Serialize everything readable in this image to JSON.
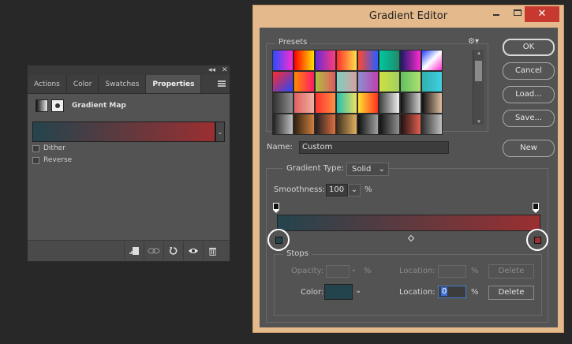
{
  "properties_panel": {
    "tabs": [
      {
        "label": "Actions",
        "active": false
      },
      {
        "label": "Color",
        "active": false
      },
      {
        "label": "Swatches",
        "active": false
      },
      {
        "label": "Properties",
        "active": true
      }
    ],
    "topstrip": {
      "collapse": "◂◂",
      "close": "✕"
    },
    "adjustment_title": "Gradient Map",
    "gradient": {
      "start_color": "#24444d",
      "end_color": "#9b2f31"
    },
    "dropdown_arrow": "⌄",
    "dither_label": "Dither",
    "reverse_label": "Reverse",
    "dither_checked": false,
    "reverse_checked": false,
    "bottom_icons": [
      "clip-to-layer-icon",
      "view-previous-icon",
      "reset-icon",
      "visibility-eye-icon",
      "trash-icon"
    ]
  },
  "gradient_editor": {
    "title": "Gradient Editor",
    "titlebar": {
      "minimize": "",
      "maximize": "",
      "close": "✕"
    },
    "presets_label": "Presets",
    "gear": "⚙▾",
    "preset_swatches": [
      "linear-gradient(90deg,#2a4cff,#ff2bd0)",
      "linear-gradient(90deg,#ff0000,#ffe000)",
      "linear-gradient(90deg,#6a2bd6,#ff3b7a)",
      "linear-gradient(90deg,#ff2d2d,#ffe14a)",
      "linear-gradient(90deg,#ff4a2a,#2a5bff)",
      "linear-gradient(90deg,#00c8a0,#1f8a6c)",
      "linear-gradient(90deg,#1a1a6a,#ff2bd0)",
      "linear-gradient(135deg,#1f3cff,#ffffff,#ff2bd0)",
      "linear-gradient(135deg,#ff2a2a,#2a46ff)",
      "linear-gradient(90deg,#ff8a00,#ff1a6a)",
      "linear-gradient(90deg,#b0c040,#e05a60)",
      "linear-gradient(90deg,#7ad0c0,#d8a0a0)",
      "linear-gradient(90deg,#8a90d0,#c040b0)",
      "linear-gradient(90deg,#d0e040,#a0d060)",
      "linear-gradient(90deg,#60c060,#b0e070)",
      "linear-gradient(90deg,#30b0b0,#40d0e0)",
      "linear-gradient(90deg,#303030,#909090)",
      "linear-gradient(90deg,#e06060,#f0b0a0)",
      "linear-gradient(90deg,#ff3030,#ff9040)",
      "linear-gradient(90deg,#20c0b0,#f0e060)",
      "linear-gradient(90deg,#ffe030,#ff3020)",
      "linear-gradient(90deg,#404040,#f0f0f0)",
      "linear-gradient(90deg,#101010,#d0d0d0)",
      "linear-gradient(90deg,#101010,#e0c0a0)",
      "linear-gradient(90deg,#202020,#c0c0c0)",
      "linear-gradient(90deg,#302010,#d08040)",
      "linear-gradient(90deg,#202020,#e07040)",
      "linear-gradient(90deg,#403020,#e0b060)",
      "linear-gradient(90deg,#101010,#a0a0a0)",
      "linear-gradient(90deg,#101010,#909090)",
      "linear-gradient(90deg,#201010,#e06050)",
      "linear-gradient(90deg,#303030,#c0c0c0)"
    ],
    "scroll": {
      "up": "▴",
      "down": "▾"
    },
    "buttons": {
      "ok": "OK",
      "cancel": "Cancel",
      "load": "Load...",
      "save": "Save...",
      "new": "New"
    },
    "name_label": "Name:",
    "name_value": "Custom",
    "gradient_type_label": "Gradient Type:",
    "gradient_type_value": "Solid",
    "smoothness_label": "Smoothness:",
    "smoothness_value": "100",
    "percent": "%",
    "dropdown_arrow": "⌄",
    "gradient": {
      "start_color": "#24444d",
      "end_color": "#9b2f31"
    },
    "stops": {
      "legend": "Stops",
      "opacity_label": "Opacity:",
      "opacity_value": "",
      "location_label": "Location:",
      "opacity_location_value": "",
      "color_label": "Color:",
      "color_swatch": "#24444d",
      "color_location_value": "0",
      "delete_label": "Delete"
    }
  }
}
